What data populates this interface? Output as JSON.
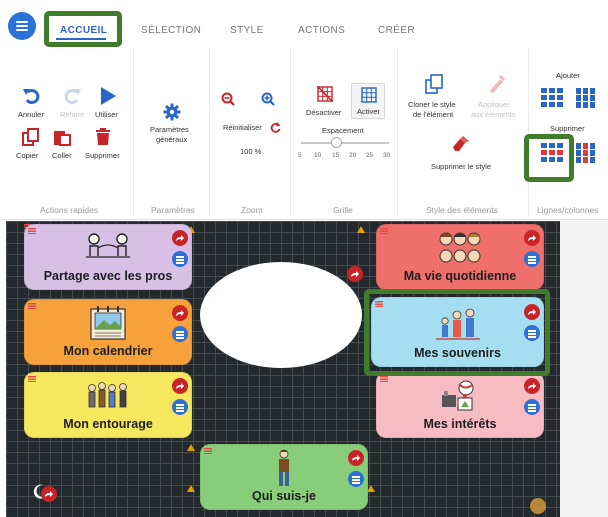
{
  "tabs": [
    {
      "label": "ACCUEIL",
      "active": true
    },
    {
      "label": "SÉLECTION",
      "active": false
    },
    {
      "label": "STYLE",
      "active": false
    },
    {
      "label": "ACTIONS",
      "active": false
    },
    {
      "label": "CRÉER",
      "active": false
    }
  ],
  "ribbon": {
    "quick_actions": {
      "group_label": "Actions rapides",
      "undo": "Annuler",
      "redo": "Refaire",
      "use": "Utiliser",
      "copy": "Copier",
      "paste": "Coller",
      "delete": "Supprimer"
    },
    "settings": {
      "group_label": "Paramètres",
      "general_line1": "Paramètres",
      "general_line2": "généraux"
    },
    "zoom": {
      "group_label": "Zoom",
      "reset": "Réinitialiser",
      "value": "100 %"
    },
    "grid": {
      "group_label": "Grille",
      "deactivate": "Désactiver",
      "activate": "Activer",
      "spacing_label": "Espacement",
      "ticks": [
        "5",
        "10",
        "15",
        "20",
        "25",
        "30"
      ],
      "spacing_value": 15
    },
    "element_style": {
      "group_label": "Style des éléments",
      "clone_line1": "Cloner le style",
      "clone_line2": "de l'élément",
      "apply_line1": "Appliquer",
      "apply_line2": "aux éléments",
      "remove_style": "Supprimer le style"
    },
    "rows_cols": {
      "group_label": "Lignes/colonnes",
      "add": "Ajouter",
      "remove": "Supprimer"
    }
  },
  "cards": [
    {
      "label": "Partage avec les pros",
      "color": "#d8bfe6"
    },
    {
      "label": "Ma vie quotidienne",
      "color": "#ef6f6a"
    },
    {
      "label": "Mon calendrier",
      "color": "#f6a13a"
    },
    {
      "label": "Mes souvenirs",
      "color": "#a6def1"
    },
    {
      "label": "Mon entourage",
      "color": "#f5e75e"
    },
    {
      "label": "Mes intérêts",
      "color": "#f7bcc1"
    },
    {
      "label": "Qui suis-je",
      "color": "#88cd7a"
    }
  ],
  "colors": {
    "accent": "#2a66c8",
    "highlight": "#3f7d2a",
    "board_bg": "#23292c",
    "arrow_button": "#c9242a",
    "list_button": "#2f6fd6"
  }
}
